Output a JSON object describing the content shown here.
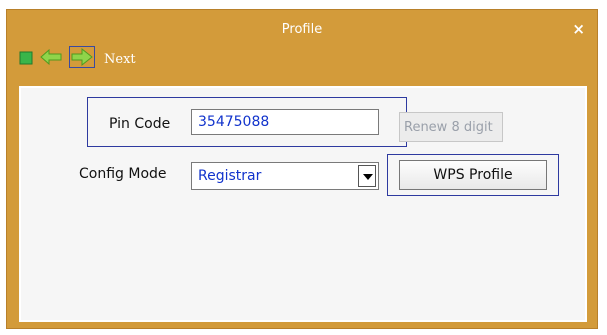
{
  "window": {
    "title": "Profile",
    "close_glyph": "×"
  },
  "toolbar": {
    "icons": [
      "stop-icon",
      "back-arrow-icon",
      "forward-arrow-icon"
    ],
    "next_label": "Next"
  },
  "form": {
    "pin_code_label": "Pin Code",
    "pin_code_value": "35475088",
    "renew_button": "Renew 8 digit",
    "config_mode_label": "Config Mode",
    "config_mode_value": "Registrar",
    "wps_profile_button": "WPS Profile"
  },
  "colors": {
    "window_bg": "#d39b3a",
    "panel_bg": "#f6f6f6",
    "accent_blue": "#2e3aa0",
    "value_text": "#1133cc"
  }
}
